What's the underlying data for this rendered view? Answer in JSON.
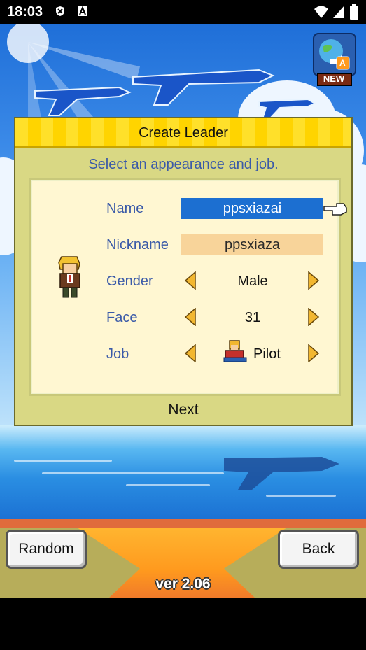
{
  "status_bar": {
    "time": "18:03"
  },
  "top_badge": {
    "label": "NEW",
    "letter": "A"
  },
  "dialog": {
    "title": "Create Leader",
    "subtitle": "Select an appearance and job.",
    "fields": {
      "name": {
        "label": "Name",
        "value": "ppsxiazai"
      },
      "nickname": {
        "label": "Nickname",
        "value": "ppsxiaza"
      },
      "gender": {
        "label": "Gender",
        "value": "Male"
      },
      "face": {
        "label": "Face",
        "value": "31"
      },
      "job": {
        "label": "Job",
        "value": "Pilot"
      }
    },
    "next_label": "Next"
  },
  "bottom": {
    "random_label": "Random",
    "back_label": "Back",
    "version": "ver 2.06"
  },
  "colors": {
    "accent_blue": "#1c6fd1",
    "label_blue": "#3a5aa8",
    "dialog_bg": "#d9d884",
    "title_yellow": "#ffe02a"
  }
}
